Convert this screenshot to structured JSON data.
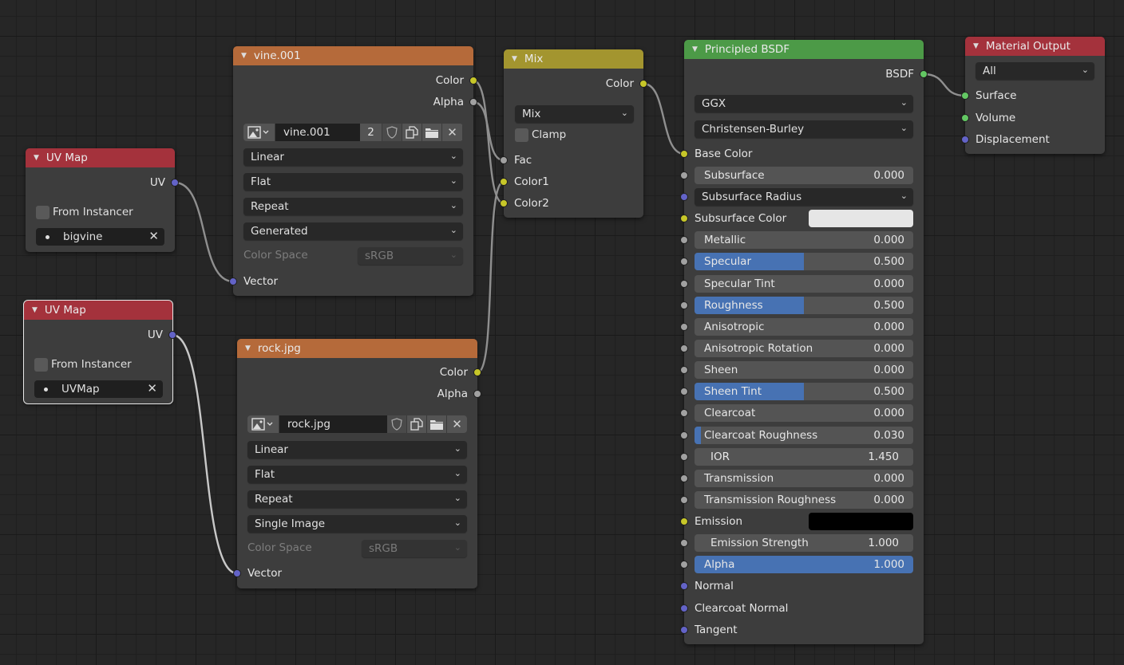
{
  "editor": "Shader Editor",
  "socket_colors": {
    "color": "#c7c729",
    "float": "#a1a1a1",
    "vector": "#6363c7",
    "shader": "#63c763"
  },
  "accent_color": "#4772b3",
  "nodes": {
    "uvmap1": {
      "title": "UV Map",
      "output_uv": "UV",
      "from_instancer_label": "From Instancer",
      "from_instancer_checked": false,
      "uv_map_value": "bigvine"
    },
    "uvmap2": {
      "title": "UV Map",
      "output_uv": "UV",
      "from_instancer_label": "From Instancer",
      "from_instancer_checked": false,
      "uv_map_value": "UVMap",
      "selected": true
    },
    "vine": {
      "title": "vine.001",
      "outputs": {
        "color": "Color",
        "alpha": "Alpha"
      },
      "image_name": "vine.001",
      "users": "2",
      "interpolation": "Linear",
      "projection": "Flat",
      "extension": "Repeat",
      "source": "Generated",
      "color_space_label": "Color Space",
      "color_space_value": "sRGB",
      "input_vector": "Vector"
    },
    "rock": {
      "title": "rock.jpg",
      "outputs": {
        "color": "Color",
        "alpha": "Alpha"
      },
      "image_name": "rock.jpg",
      "interpolation": "Linear",
      "projection": "Flat",
      "extension": "Repeat",
      "source": "Single Image",
      "color_space_label": "Color Space",
      "color_space_value": "sRGB",
      "input_vector": "Vector"
    },
    "mix": {
      "title": "Mix",
      "output_color": "Color",
      "blend_type": "Mix",
      "clamp_label": "Clamp",
      "clamp_checked": false,
      "inputs": {
        "fac": "Fac",
        "color1": "Color1",
        "color2": "Color2"
      }
    },
    "principled": {
      "title": "Principled BSDF",
      "output_bsdf": "BSDF",
      "distribution": "GGX",
      "subsurface_method": "Christensen-Burley",
      "base_color_label": "Base Color",
      "subsurface": {
        "label": "Subsurface",
        "value": "0.000",
        "fraction": 0
      },
      "subsurface_radius_label": "Subsurface Radius",
      "subsurface_color": {
        "label": "Subsurface Color",
        "swatch": "#e6e6e6"
      },
      "metallic": {
        "label": "Metallic",
        "value": "0.000",
        "fraction": 0
      },
      "specular": {
        "label": "Specular",
        "value": "0.500",
        "fraction": 0.5
      },
      "specular_tint": {
        "label": "Specular Tint",
        "value": "0.000",
        "fraction": 0
      },
      "roughness": {
        "label": "Roughness",
        "value": "0.500",
        "fraction": 0.5
      },
      "anisotropic": {
        "label": "Anisotropic",
        "value": "0.000",
        "fraction": 0
      },
      "anisotropic_rotation": {
        "label": "Anisotropic Rotation",
        "value": "0.000",
        "fraction": 0
      },
      "sheen": {
        "label": "Sheen",
        "value": "0.000",
        "fraction": 0
      },
      "sheen_tint": {
        "label": "Sheen Tint",
        "value": "0.500",
        "fraction": 0.5
      },
      "clearcoat": {
        "label": "Clearcoat",
        "value": "0.000",
        "fraction": 0
      },
      "clearcoat_roughness": {
        "label": "Clearcoat Roughness",
        "value": "0.030",
        "fraction": 0.03
      },
      "ior": {
        "label": "IOR",
        "value": "1.450"
      },
      "transmission": {
        "label": "Transmission",
        "value": "0.000",
        "fraction": 0
      },
      "transmission_roughness": {
        "label": "Transmission Roughness",
        "value": "0.000",
        "fraction": 0
      },
      "emission": {
        "label": "Emission",
        "swatch": "#000000"
      },
      "emission_strength": {
        "label": "Emission Strength",
        "value": "1.000"
      },
      "alpha": {
        "label": "Alpha",
        "value": "1.000",
        "fraction": 1
      },
      "normal_label": "Normal",
      "clearcoat_normal_label": "Clearcoat Normal",
      "tangent_label": "Tangent"
    },
    "output": {
      "title": "Material Output",
      "target": "All",
      "inputs": {
        "surface": "Surface",
        "volume": "Volume",
        "displacement": "Displacement"
      }
    }
  },
  "links": [
    {
      "from": "uvmap1.UV",
      "to": "vine.Vector"
    },
    {
      "from": "uvmap2.UV",
      "to": "rock.Vector"
    },
    {
      "from": "vine.Color",
      "to": "mix.Color2"
    },
    {
      "from": "vine.Alpha",
      "to": "mix.Fac"
    },
    {
      "from": "rock.Color",
      "to": "mix.Color1"
    },
    {
      "from": "mix.Color",
      "to": "principled.Base Color"
    },
    {
      "from": "principled.BSDF",
      "to": "output.Surface"
    }
  ]
}
